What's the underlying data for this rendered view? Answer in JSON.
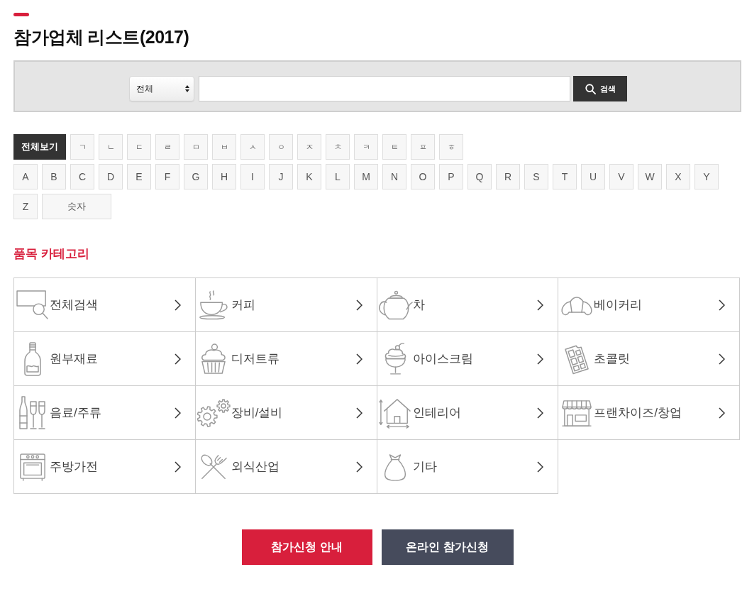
{
  "title": "참가업체 리스트(2017)",
  "search": {
    "scope": "전체",
    "button": "검색"
  },
  "index_filters": {
    "hangul": [
      {
        "label": "전체보기",
        "selected": true
      },
      {
        "label": "ㄱ",
        "selected": false
      },
      {
        "label": "ㄴ",
        "selected": false
      },
      {
        "label": "ㄷ",
        "selected": false
      },
      {
        "label": "ㄹ",
        "selected": false
      },
      {
        "label": "ㅁ",
        "selected": false
      },
      {
        "label": "ㅂ",
        "selected": false
      },
      {
        "label": "ㅅ",
        "selected": false
      },
      {
        "label": "ㅇ",
        "selected": false
      },
      {
        "label": "ㅈ",
        "selected": false
      },
      {
        "label": "ㅊ",
        "selected": false
      },
      {
        "label": "ㅋ",
        "selected": false
      },
      {
        "label": "ㅌ",
        "selected": false
      },
      {
        "label": "ㅍ",
        "selected": false
      },
      {
        "label": "ㅎ",
        "selected": false
      }
    ],
    "latin": [
      {
        "label": "A",
        "selected": false
      },
      {
        "label": "B",
        "selected": false
      },
      {
        "label": "C",
        "selected": false
      },
      {
        "label": "D",
        "selected": false
      },
      {
        "label": "E",
        "selected": false
      },
      {
        "label": "F",
        "selected": false
      },
      {
        "label": "G",
        "selected": false
      },
      {
        "label": "H",
        "selected": false
      },
      {
        "label": "I",
        "selected": false
      },
      {
        "label": "J",
        "selected": false
      },
      {
        "label": "K",
        "selected": false
      },
      {
        "label": "L",
        "selected": false
      },
      {
        "label": "M",
        "selected": false
      },
      {
        "label": "N",
        "selected": false
      },
      {
        "label": "O",
        "selected": false
      },
      {
        "label": "P",
        "selected": false
      },
      {
        "label": "Q",
        "selected": false
      },
      {
        "label": "R",
        "selected": false
      },
      {
        "label": "S",
        "selected": false
      },
      {
        "label": "T",
        "selected": false
      },
      {
        "label": "U",
        "selected": false
      },
      {
        "label": "V",
        "selected": false
      },
      {
        "label": "W",
        "selected": false
      },
      {
        "label": "X",
        "selected": false
      },
      {
        "label": "Y",
        "selected": false
      },
      {
        "label": "Z",
        "selected": false
      },
      {
        "label": "숫자",
        "selected": false
      }
    ]
  },
  "categories": {
    "title": "품목 카테고리",
    "items": [
      {
        "label": "전체검색"
      },
      {
        "label": "커피"
      },
      {
        "label": "차"
      },
      {
        "label": "베이커리"
      },
      {
        "label": "원부재료"
      },
      {
        "label": "디저트류"
      },
      {
        "label": "아이스크림"
      },
      {
        "label": "초콜릿"
      },
      {
        "label": "음료/주류"
      },
      {
        "label": "장비/설비"
      },
      {
        "label": "인테리어"
      },
      {
        "label": "프랜차이즈/창업"
      },
      {
        "label": "주방가전"
      },
      {
        "label": "외식산업"
      },
      {
        "label": "기타"
      }
    ]
  },
  "actions": [
    {
      "label": "참가신청 안내",
      "kind": "primary"
    },
    {
      "label": "온라인 참가신청",
      "kind": "secondary"
    }
  ]
}
